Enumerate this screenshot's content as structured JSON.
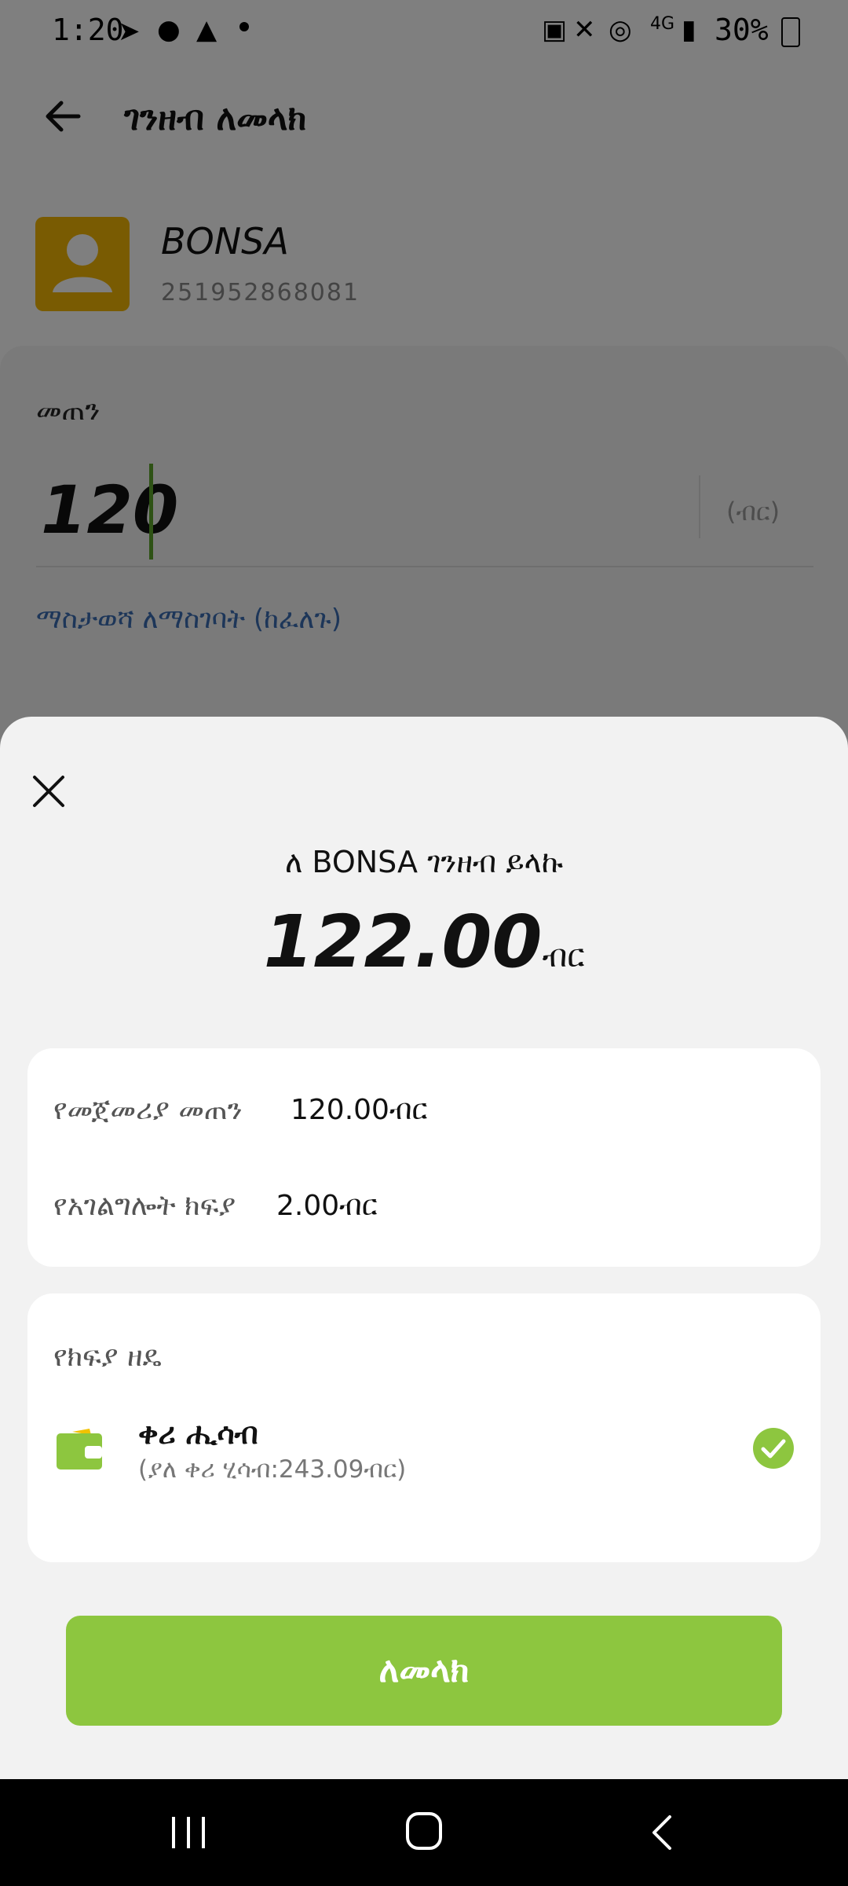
{
  "status_bar": {
    "time": "1:20",
    "battery": "30%"
  },
  "appbar": {
    "title": "ገንዘብ ለመላክ"
  },
  "contact": {
    "name": "BONSA",
    "phone": "251952868081"
  },
  "amount": {
    "label": "መጠን",
    "value": "120",
    "currency": "(ብር)",
    "note_link": "ማስታወሻ ለማስገባት (ከፈለጉ)"
  },
  "sheet": {
    "title": "ለ BONSA ገንዘብ ይላኩ",
    "total_amount": "122.00",
    "total_unit": "ብር",
    "breakdown": [
      {
        "label": "የመጀመሪያ መጠን",
        "value": "120.00ብር"
      },
      {
        "label": "የአገልግሎት ክፍያ",
        "value": "2.00ብር"
      }
    ],
    "payment_method": {
      "title": "የክፍያ ዘዴ",
      "name": "ቀሪ ሒሳብ",
      "balance": "(ያለ ቀሪ ሂሳብ:243.09ብር)"
    },
    "send_label": "ለመላክ"
  },
  "colors": {
    "accent": "#8dc63f",
    "avatar": "#f2b705",
    "link": "#3b6db3"
  }
}
